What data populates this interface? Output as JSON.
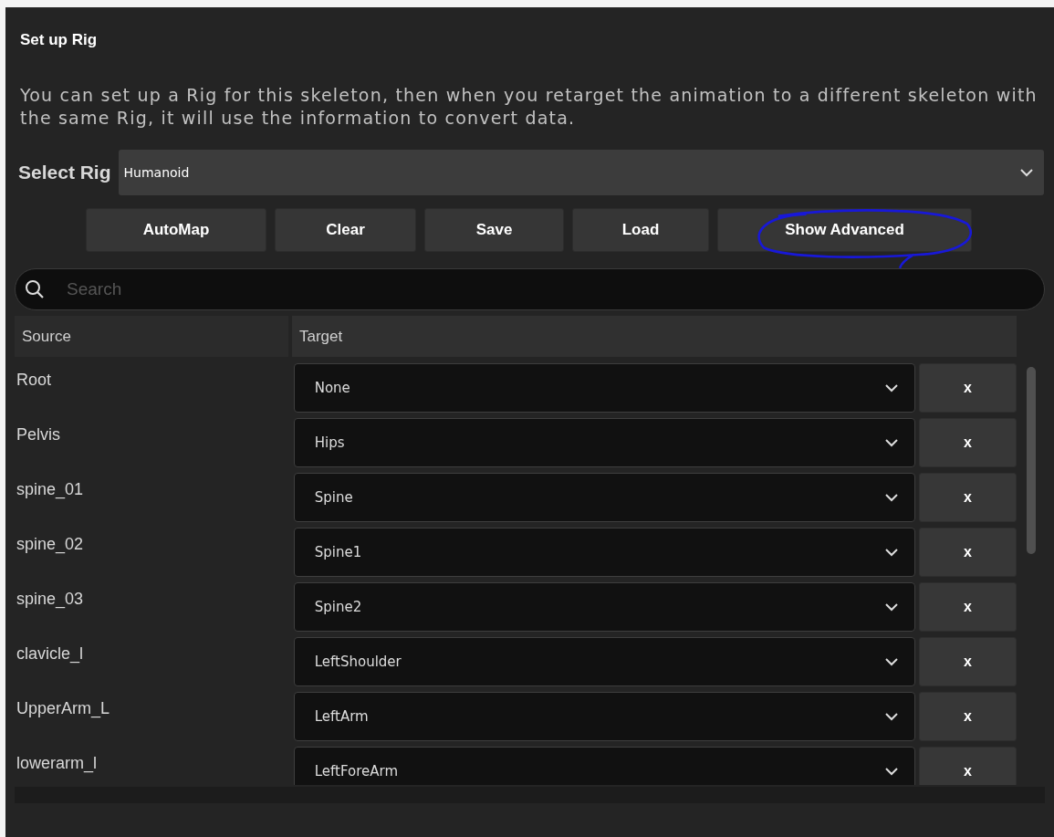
{
  "title": "Set up Rig",
  "description": "You can set up a Rig for this skeleton, then when you retarget the animation to a different skeleton with the same Rig, it will use the information to convert data.",
  "select_rig": {
    "label": "Select Rig",
    "value": "Humanoid"
  },
  "buttons": [
    {
      "label": "AutoMap",
      "circled": false
    },
    {
      "label": "Clear",
      "circled": false
    },
    {
      "label": "Save",
      "circled": false
    },
    {
      "label": "Load",
      "circled": false
    },
    {
      "label": "Show Advanced",
      "circled": true
    }
  ],
  "search": {
    "placeholder": "Search"
  },
  "table": {
    "columns": [
      "Source",
      "Target"
    ],
    "rows": [
      {
        "source": "Root",
        "target": "None",
        "clear": "x"
      },
      {
        "source": "Pelvis",
        "target": "Hips",
        "clear": "x"
      },
      {
        "source": "spine_01",
        "target": "Spine",
        "clear": "x"
      },
      {
        "source": "spine_02",
        "target": "Spine1",
        "clear": "x"
      },
      {
        "source": "spine_03",
        "target": "Spine2",
        "clear": "x"
      },
      {
        "source": "clavicle_l",
        "target": "LeftShoulder",
        "clear": "x"
      },
      {
        "source": "UpperArm_L",
        "target": "LeftArm",
        "clear": "x"
      },
      {
        "source": "lowerarm_l",
        "target": "LeftForeArm",
        "clear": "x"
      }
    ]
  }
}
